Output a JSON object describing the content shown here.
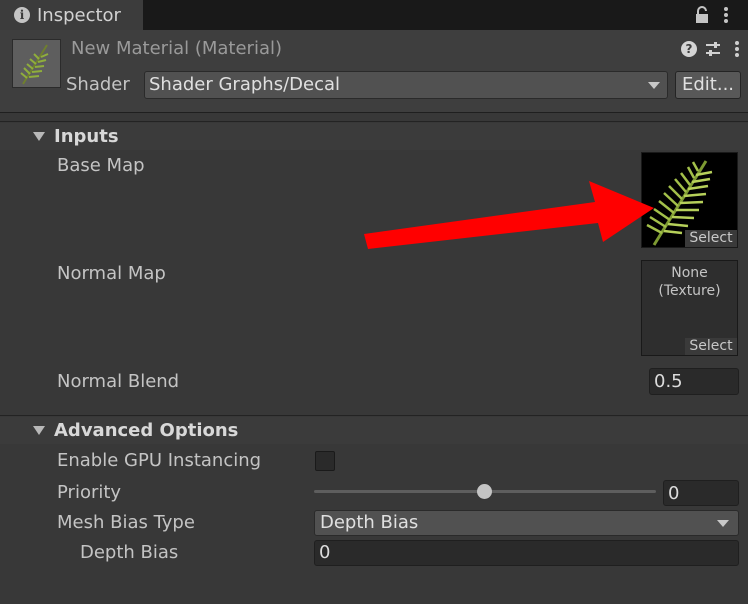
{
  "window": {
    "tab_title": "Inspector"
  },
  "header": {
    "title": "New Material (Material)",
    "shader_label": "Shader",
    "shader_value": "Shader Graphs/Decal",
    "edit_label": "Edit..."
  },
  "inputs": {
    "section_title": "Inputs",
    "base_map_label": "Base Map",
    "base_map_select": "Select",
    "normal_map_label": "Normal Map",
    "normal_map_none_line1": "None",
    "normal_map_none_line2": "(Texture)",
    "normal_map_select": "Select",
    "normal_blend_label": "Normal Blend",
    "normal_blend_value": "0.5"
  },
  "advanced": {
    "section_title": "Advanced Options",
    "gpu_instancing_label": "Enable GPU Instancing",
    "gpu_instancing_checked": false,
    "priority_label": "Priority",
    "priority_value": "0",
    "mesh_bias_type_label": "Mesh Bias Type",
    "mesh_bias_type_value": "Depth Bias",
    "depth_bias_label": "Depth Bias",
    "depth_bias_value": "0"
  },
  "colors": {
    "annotation_arrow": "#ff0000",
    "foliage": "#8fae3c"
  },
  "icons": [
    "info-icon",
    "lock-icon",
    "kebab-menu-icon",
    "help-icon",
    "settings-sliders-icon",
    "chevron-down-icon",
    "foldout-arrow-icon",
    "material-thumbnail",
    "annotation-arrow"
  ]
}
